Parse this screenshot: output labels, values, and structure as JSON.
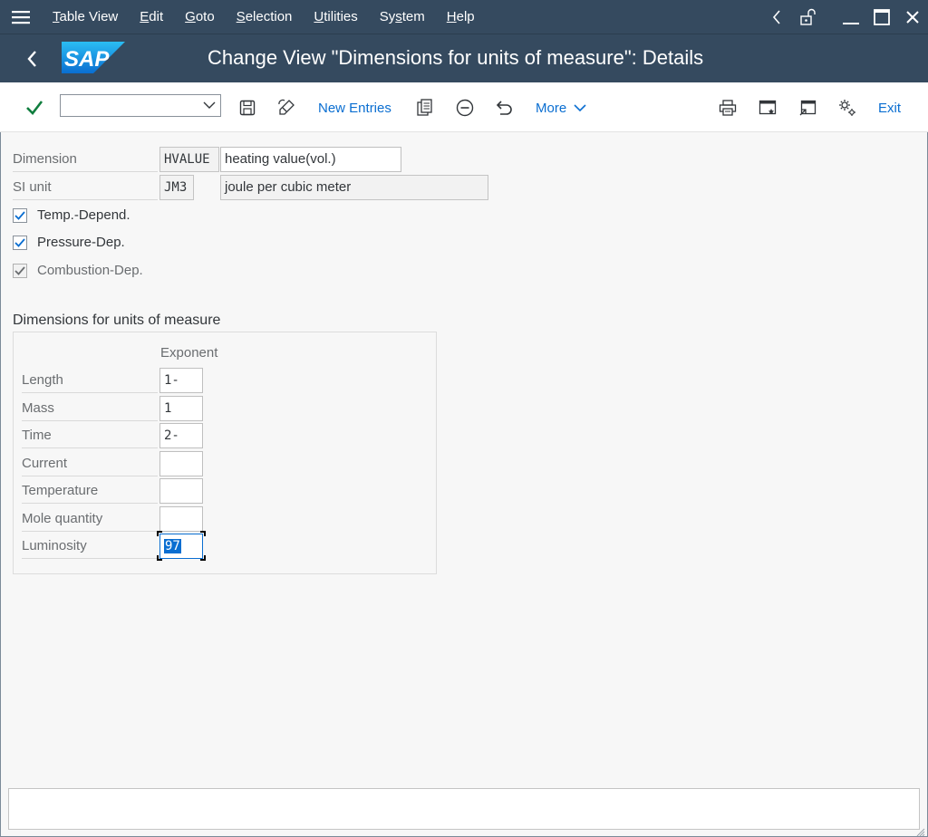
{
  "menubar": {
    "items": [
      {
        "pre": "",
        "u": "T",
        "post": "able View"
      },
      {
        "pre": "",
        "u": "E",
        "post": "dit"
      },
      {
        "pre": "",
        "u": "G",
        "post": "oto"
      },
      {
        "pre": "",
        "u": "S",
        "post": "election"
      },
      {
        "pre": "",
        "u": "U",
        "post": "tilities"
      },
      {
        "pre": "Sy",
        "u": "s",
        "post": "tem"
      },
      {
        "pre": "",
        "u": "H",
        "post": "elp"
      }
    ]
  },
  "title": {
    "logo_text": "SAP",
    "text": "Change View \"Dimensions for units of measure\": Details"
  },
  "toolbar": {
    "command_value": "",
    "new_entries_label": "New Entries",
    "more_label": "More",
    "exit_label": "Exit"
  },
  "form": {
    "dimension": {
      "label": "Dimension",
      "code": "HVALUE",
      "text": "heating value(vol.)"
    },
    "si_unit": {
      "label": "SI unit",
      "code": "JM3",
      "text": "joule per cubic meter"
    },
    "checkboxes": [
      {
        "label": "Temp.-Depend.",
        "checked": true,
        "enabled": true
      },
      {
        "label": "Pressure-Dep.",
        "checked": true,
        "enabled": true
      },
      {
        "label": "Combustion-Dep.",
        "checked": true,
        "enabled": false
      }
    ]
  },
  "dimensions_section": {
    "title": "Dimensions for units of measure",
    "column_header": "Exponent",
    "rows": [
      {
        "label": "Length",
        "exponent": "1-"
      },
      {
        "label": "Mass",
        "exponent": "1"
      },
      {
        "label": "Time",
        "exponent": "2-"
      },
      {
        "label": "Current",
        "exponent": ""
      },
      {
        "label": "Temperature",
        "exponent": ""
      },
      {
        "label": "Mole quantity",
        "exponent": ""
      },
      {
        "label": "Luminosity",
        "exponent": "97"
      }
    ]
  },
  "statusbar": {
    "text": ""
  },
  "colors": {
    "shell": "#354a5f",
    "accent": "#0a6ed1",
    "check": "#107e3e",
    "background": "#f7f7f7"
  }
}
